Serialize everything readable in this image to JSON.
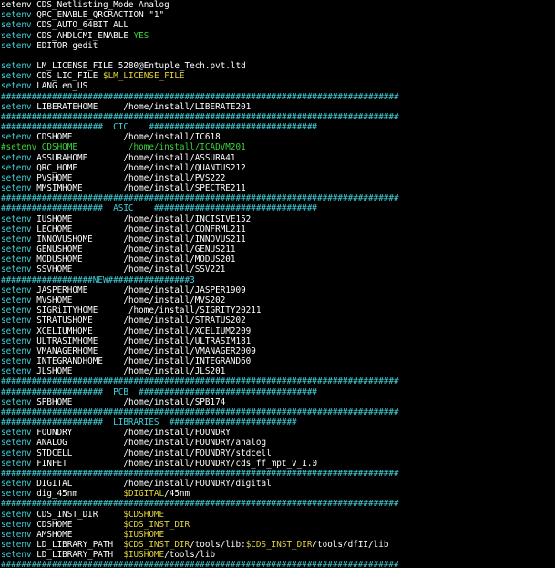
{
  "colors": {
    "background": "#000000",
    "white": "#ffffff",
    "cyan": "#3fd0d8",
    "green": "#3cd23c",
    "yellow": "#e0d23a"
  },
  "lines": [
    [
      {
        "t": "setenv CDS_Netlisting_Mode Analog",
        "c": "white"
      }
    ],
    [
      {
        "t": "setenv",
        "c": "cyan"
      },
      {
        "t": " QRC_ENABLE_QRCRACTION \"1\"",
        "c": "white"
      }
    ],
    [
      {
        "t": "setenv",
        "c": "cyan"
      },
      {
        "t": " CDS_AUTO_64BIT ALL",
        "c": "white"
      }
    ],
    [
      {
        "t": "setenv",
        "c": "cyan"
      },
      {
        "t": " CDS_AHDLCMI_ENABLE ",
        "c": "white"
      },
      {
        "t": "YES",
        "c": "green"
      }
    ],
    [
      {
        "t": "setenv",
        "c": "cyan"
      },
      {
        "t": " EDITOR gedit",
        "c": "white"
      }
    ],
    [],
    [
      {
        "t": "setenv",
        "c": "cyan"
      },
      {
        "t": " LM_LICENSE_FILE 5280@Entuple_Tech.pvt.ltd",
        "c": "white"
      }
    ],
    [
      {
        "t": "setenv",
        "c": "cyan"
      },
      {
        "t": " CDS_LIC_FILE ",
        "c": "white"
      },
      {
        "t": "$LM_LICENSE_FILE",
        "c": "yellow"
      }
    ],
    [
      {
        "t": "setenv",
        "c": "cyan"
      },
      {
        "t": " LANG en_US",
        "c": "white"
      }
    ],
    [
      {
        "t": "##############################################################################",
        "c": "cyan"
      }
    ],
    [
      {
        "t": "setenv",
        "c": "cyan"
      },
      {
        "t": " LIBERATEHOME     /home/install/LIBERATE201",
        "c": "white"
      }
    ],
    [
      {
        "t": "##############################################################################",
        "c": "cyan"
      }
    ],
    [
      {
        "t": "####################  CIC    #################################",
        "c": "cyan"
      }
    ],
    [
      {
        "t": "setenv",
        "c": "cyan"
      },
      {
        "t": " CDSHOME          /home/install/IC618",
        "c": "white"
      }
    ],
    [
      {
        "t": "#setenv CDSHOME          /home/install/ICADVM201",
        "c": "green"
      }
    ],
    [
      {
        "t": "setenv",
        "c": "cyan"
      },
      {
        "t": " ASSURAHOME       /home/install/ASSURA41",
        "c": "white"
      }
    ],
    [
      {
        "t": "setenv",
        "c": "cyan"
      },
      {
        "t": " QRC_HOME         /home/install/QUANTUS212",
        "c": "white"
      }
    ],
    [
      {
        "t": "setenv",
        "c": "cyan"
      },
      {
        "t": " PVSHOME          /home/install/PVS222",
        "c": "white"
      }
    ],
    [
      {
        "t": "setenv",
        "c": "cyan"
      },
      {
        "t": " MMSIMHOME        /home/install/SPECTRE211",
        "c": "white"
      }
    ],
    [
      {
        "t": "##############################################################################",
        "c": "cyan"
      }
    ],
    [
      {
        "t": "####################  ASIC    ################################",
        "c": "cyan"
      }
    ],
    [
      {
        "t": "setenv",
        "c": "cyan"
      },
      {
        "t": " IUSHOME          /home/install/INCISIVE152",
        "c": "white"
      }
    ],
    [
      {
        "t": "setenv",
        "c": "cyan"
      },
      {
        "t": " LECHOME          /home/install/CONFRML211",
        "c": "white"
      }
    ],
    [
      {
        "t": "setenv",
        "c": "cyan"
      },
      {
        "t": " INNOVUSHOME      /home/install/INNOVUS211",
        "c": "white"
      }
    ],
    [
      {
        "t": "setenv",
        "c": "cyan"
      },
      {
        "t": " GENUSHOME        /home/install/GENUS211",
        "c": "white"
      }
    ],
    [
      {
        "t": "setenv",
        "c": "cyan"
      },
      {
        "t": " MODUSHOME        /home/install/MODUS201",
        "c": "white"
      }
    ],
    [
      {
        "t": "setenv",
        "c": "cyan"
      },
      {
        "t": " SSVHOME          /home/install/SSV221",
        "c": "white"
      }
    ],
    [
      {
        "t": "##################NEW################3",
        "c": "cyan"
      }
    ],
    [
      {
        "t": "setenv",
        "c": "cyan"
      },
      {
        "t": " JASPERHOME       /home/install/JASPER1909",
        "c": "white"
      }
    ],
    [
      {
        "t": "setenv",
        "c": "cyan"
      },
      {
        "t": " MVSHOME          /home/install/MVS202",
        "c": "white"
      }
    ],
    [
      {
        "t": "setenv",
        "c": "cyan"
      },
      {
        "t": " SIGRiITYHOME      /home/install/SIGRITY20211",
        "c": "white"
      }
    ],
    [
      {
        "t": "setenv",
        "c": "cyan"
      },
      {
        "t": " STRATUSHOME      /home/install/STRATUS202",
        "c": "white"
      }
    ],
    [
      {
        "t": "setenv",
        "c": "cyan"
      },
      {
        "t": " XCELIUMHOME      /home/install/XCELIUM2209",
        "c": "white"
      }
    ],
    [
      {
        "t": "setenv",
        "c": "cyan"
      },
      {
        "t": " ULTRASIMHOME     /home/install/ULTRASIM181",
        "c": "white"
      }
    ],
    [
      {
        "t": "setenv",
        "c": "cyan"
      },
      {
        "t": " VMANAGERHOME     /home/install/VMANAGER2009",
        "c": "white"
      }
    ],
    [
      {
        "t": "setenv",
        "c": "cyan"
      },
      {
        "t": " INTEGRANDHOME    /home/install/INTEGRAND60",
        "c": "white"
      }
    ],
    [
      {
        "t": "setenv",
        "c": "cyan"
      },
      {
        "t": " JLSHOME          /home/install/JLS201",
        "c": "white"
      }
    ],
    [
      {
        "t": "##############################################################################",
        "c": "cyan"
      }
    ],
    [
      {
        "t": "####################  PCB  ###################################",
        "c": "cyan"
      }
    ],
    [
      {
        "t": "setenv",
        "c": "cyan"
      },
      {
        "t": " SPBHOME          /home/install/SPB174",
        "c": "white"
      }
    ],
    [
      {
        "t": "##############################################################################",
        "c": "cyan"
      }
    ],
    [
      {
        "t": "####################  LIBRARIES  #########################",
        "c": "cyan"
      }
    ],
    [
      {
        "t": "setenv",
        "c": "cyan"
      },
      {
        "t": " FOUNDRY          /home/install/FOUNDRY",
        "c": "white"
      }
    ],
    [
      {
        "t": "setenv",
        "c": "cyan"
      },
      {
        "t": " ANALOG           /home/install/FOUNDRY/analog",
        "c": "white"
      }
    ],
    [
      {
        "t": "setenv",
        "c": "cyan"
      },
      {
        "t": " STDCELL          /home/install/FOUNDRY/stdcell",
        "c": "white"
      }
    ],
    [
      {
        "t": "setenv",
        "c": "cyan"
      },
      {
        "t": " FINFET           /home/install/FOUNDRY/cds_ff_mpt_v_1.0",
        "c": "white"
      }
    ],
    [
      {
        "t": "##############################################################################",
        "c": "cyan"
      }
    ],
    [
      {
        "t": "setenv",
        "c": "cyan"
      },
      {
        "t": " DIGITAL          /home/install/FOUNDRY/digital",
        "c": "white"
      }
    ],
    [
      {
        "t": "setenv",
        "c": "cyan"
      },
      {
        "t": " dig_45nm         ",
        "c": "white"
      },
      {
        "t": "$DIGITAL",
        "c": "yellow"
      },
      {
        "t": "/45nm",
        "c": "white"
      }
    ],
    [
      {
        "t": "##############################################################################",
        "c": "cyan"
      }
    ],
    [
      {
        "t": "setenv",
        "c": "cyan"
      },
      {
        "t": " CDS_INST_DIR     ",
        "c": "white"
      },
      {
        "t": "$CDSHOME",
        "c": "yellow"
      }
    ],
    [
      {
        "t": "setenv",
        "c": "cyan"
      },
      {
        "t": " CDSHOME          ",
        "c": "white"
      },
      {
        "t": "$CDS_INST_DIR",
        "c": "yellow"
      }
    ],
    [
      {
        "t": "setenv",
        "c": "cyan"
      },
      {
        "t": " AMSHOME          ",
        "c": "white"
      },
      {
        "t": "$IUSHOME",
        "c": "yellow"
      }
    ],
    [
      {
        "t": "setenv",
        "c": "cyan"
      },
      {
        "t": " LD_LIBRARY_PATH  ",
        "c": "white"
      },
      {
        "t": "$CDS_INST_DIR",
        "c": "yellow"
      },
      {
        "t": "/tools/lib:",
        "c": "white"
      },
      {
        "t": "$CDS_INST_DIR",
        "c": "yellow"
      },
      {
        "t": "/tools/dfII/lib",
        "c": "white"
      }
    ],
    [
      {
        "t": "setenv",
        "c": "cyan"
      },
      {
        "t": " LD_LIBRARY_PATH  ",
        "c": "white"
      },
      {
        "t": "$IUSHOME",
        "c": "yellow"
      },
      {
        "t": "/tools/lib",
        "c": "white"
      }
    ],
    [
      {
        "t": "##############################################################################",
        "c": "cyan"
      }
    ]
  ]
}
